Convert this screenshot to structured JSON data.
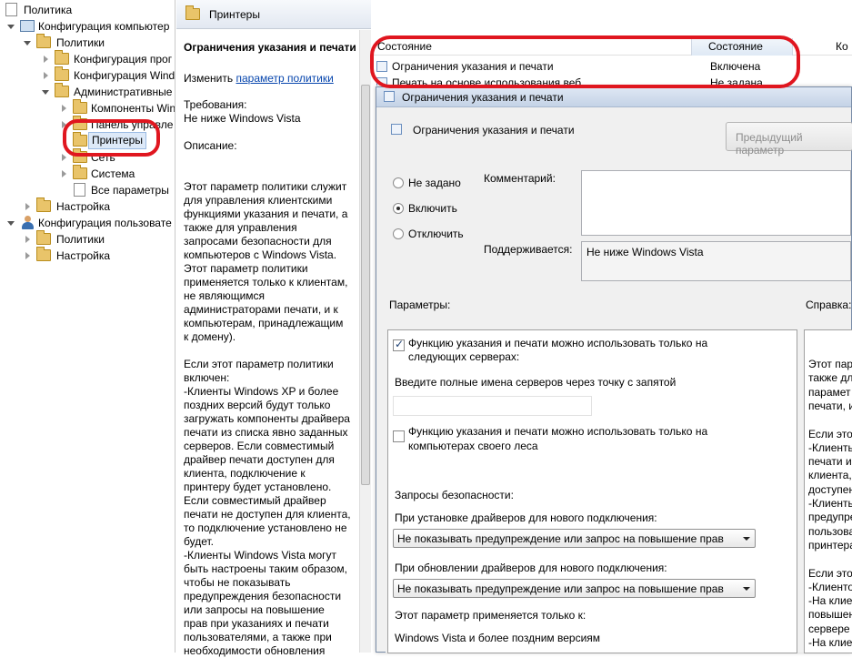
{
  "tree": {
    "root": "Политика",
    "computer_config": "Конфигурация компьютер",
    "policies": "Политики",
    "prog_config": "Конфигурация прог",
    "win_config": "Конфигурация Wind",
    "admin_templates": "Административные",
    "win_components": "Компоненты Win",
    "control_panel": "Панель управле",
    "printers": "Принтеры",
    "network": "Сеть",
    "system": "Система",
    "all_settings": "Все параметры",
    "settings": "Настройка",
    "user_config": "Конфигурация пользовате",
    "user_policies": "Политики",
    "user_settings": "Настройка"
  },
  "middle": {
    "header": "Принтеры",
    "policy_title": "Ограничения указания и печати",
    "edit_prefix": "Изменить",
    "edit_link": "параметр политики",
    "requirements_label": "Требования:",
    "requirements_value": "Не ниже Windows Vista",
    "description_label": "Описание:",
    "description_lines": [
      "Этот параметр политики служит",
      "для управления клиентскими",
      "функциями указания и печати, а",
      "также для управления",
      "запросами безопасности для",
      "компьютеров с Windows Vista.",
      "Этот параметр политики",
      "применяется только к клиентам,",
      "не являющимся",
      "администраторами печати, и к",
      "компьютерам, принадлежащим",
      "к домену).",
      "",
      "Если этот параметр политики",
      "включен:",
      "-Клиенты Windows XP и более",
      "поздних версий будут только",
      "загружать компоненты драйвера",
      "печати из списка явно заданных",
      "серверов. Если совместимый",
      "драйвер печати доступен для",
      "клиента, подключение к",
      "принтеру будет установлено.",
      "Если совместимый драйвер",
      "печати не доступен для клиента,",
      "то подключение установлено не",
      "будет.",
      "-Клиенты Windows Vista могут",
      "быть настроены таким образом,",
      "чтобы не показывать",
      "предупреждения безопасности",
      "или запросы на повышение",
      "прав при указаниях и печати",
      "пользователями, а также при",
      "необходимости обновления"
    ]
  },
  "list": {
    "col_setting": "Состояние",
    "col_state": "Состояние",
    "col_comment": "Ко",
    "rows": [
      {
        "title": "Ограничения указания и печати",
        "state": "Включена"
      },
      {
        "title": "Печать на основе использования веб",
        "state": "Не задана"
      }
    ]
  },
  "dialog": {
    "title": "Ограничения указания и печати",
    "heading": "Ограничения указания и печати",
    "prev_button": "Предыдущий параметр",
    "radio_not_configured": "Не задано",
    "radio_enable": "Включить",
    "radio_disable": "Отключить",
    "comment_label": "Комментарий:",
    "supported_label": "Поддерживается:",
    "supported_value": "Не ниже Windows Vista",
    "options_label": "Параметры:",
    "help_label": "Справка:",
    "options": {
      "chk1_line1": "Функцию указания и печати можно использовать только на",
      "chk1_line2": "следующих серверах:",
      "servers_label": "Введите полные имена серверов через точку с запятой",
      "chk2_line1": "Функцию указания и печати можно использовать только на",
      "chk2_line2": "компьютерах своего леса",
      "security_label": "Запросы безопасности:",
      "new_conn_label": "При установке драйверов для нового подключения:",
      "new_conn_value": "Не показывать предупреждение или запрос на повышение прав",
      "update_label": "При обновлении драйверов для нового подключения:",
      "update_value": "Не показывать предупреждение или запрос на повышение прав",
      "applies_label": "Этот параметр применяется только к:",
      "applies_value": "Windows Vista и более поздним версиям"
    },
    "help_lines": [
      "Этот пара",
      "также для",
      "парамет",
      "печати, и",
      "",
      "Если этот",
      "-Клиенты",
      "печати из",
      "клиента,",
      "доступен",
      "-Клиенты",
      "предупре",
      "пользова",
      "принтера",
      "",
      "Если этот",
      "-Клиенто",
      "-На клие",
      "повышен",
      "сервере с",
      "-На клие",
      "повышен"
    ]
  },
  "annotations": {
    "color": "#e0161f"
  }
}
